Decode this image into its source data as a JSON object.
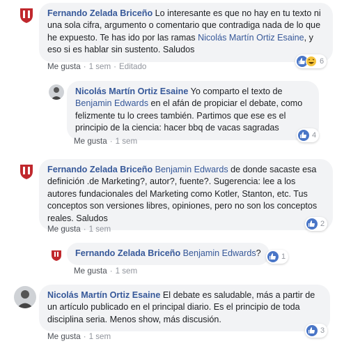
{
  "comments": [
    {
      "author": "Fernando Zelada Briceño",
      "text_before": " Lo interesante es que no hay en tu texto ni una sola cifra, argumento o comentario que contradiga nada de lo que he expuesto. Te has ido por las ramas ",
      "mention": "Nicolás Martín Ortiz Esaine",
      "text_after": ", y eso si es hablar sin sustento. Saludos",
      "like_label": "Me gusta",
      "time": "1 sem",
      "edited": "Editado",
      "reaction_count": "6",
      "reactions": [
        "like-icon",
        "haha-icon"
      ]
    },
    {
      "author": "Nicolás Martín Ortiz Esaine",
      "text_before": " Yo comparto el texto de ",
      "mention": "Benjamin Edwards",
      "text_after": " en el afán de propiciar el debate, como felizmente tu lo crees también. Partimos que ese es el principio de la ciencia: hacer bbq de vacas sagradas",
      "like_label": "Me gusta",
      "time": "1 sem",
      "reaction_count": "4",
      "reactions": [
        "like-icon"
      ]
    },
    {
      "author": "Fernando Zelada Briceño",
      "text_before": " ",
      "mention": "Benjamin Edwards",
      "text_after": " de donde sacaste esa definición .de Marketing?, autor?, fuente?. Sugerencia: lee a los autores fundacionales del Marketing como Kotler, Stanton, etc. Tus conceptos son versiones libres, opiniones, pero no son los conceptos reales. Saludos",
      "like_label": "Me gusta",
      "time": "1 sem",
      "reaction_count": "2",
      "reactions": [
        "like-icon"
      ]
    },
    {
      "author": "Fernando Zelada Briceño",
      "text_before": " ",
      "mention": "Benjamin Edwards",
      "text_after": "?",
      "like_label": "Me gusta",
      "time": "1 sem",
      "reaction_count": "1",
      "reactions": [
        "like-icon"
      ]
    },
    {
      "author": "Nicolás Martín Ortiz Esaine",
      "text_before": " El debate es saludable, más a partir de un artículo publicado en el principal diario. Es el principio de toda disciplina seria. Menos show, más discusión.",
      "mention": "",
      "text_after": "",
      "like_label": "Me gusta",
      "time": "1 sem",
      "reaction_count": "3",
      "reactions": [
        "like-icon"
      ]
    }
  ],
  "separator": "·",
  "colors": {
    "link": "#365899",
    "bubble": "#f2f3f5",
    "meta": "#90949c",
    "like_blue": "#4a76c7",
    "haha_yellow": "#f5c33b",
    "avatar_red": "#c0282d"
  }
}
